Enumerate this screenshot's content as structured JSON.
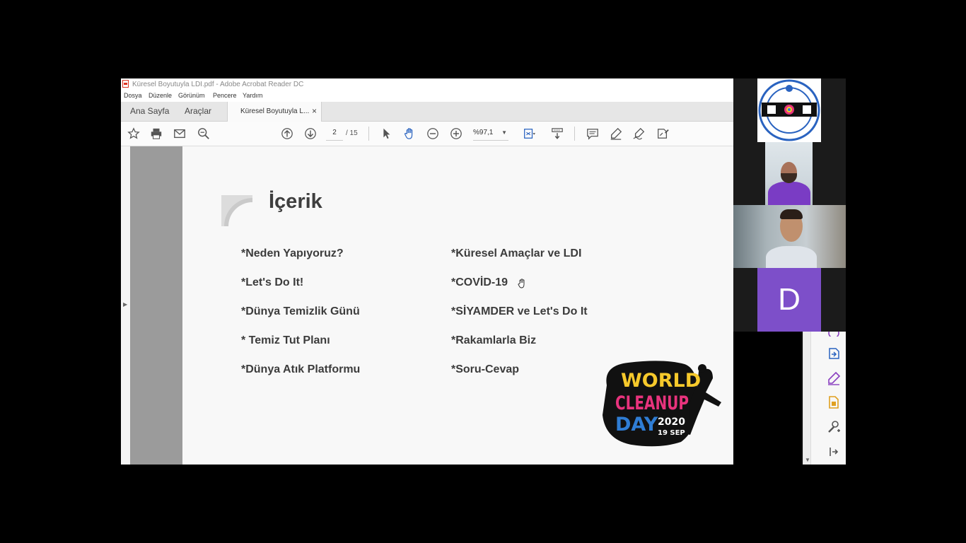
{
  "window": {
    "title": "Küresel Boyutuyla LDI.pdf - Adobe Acrobat Reader DC"
  },
  "menu": [
    "Dosya",
    "Düzenle",
    "Görünüm",
    "Pencere",
    "Yardım"
  ],
  "tabs": {
    "home": "Ana Sayfa",
    "tools": "Araçlar",
    "document": "Küresel Boyutuyla L...",
    "close_glyph": "×"
  },
  "toolbar": {
    "current_page": "2",
    "total_pages": "/ 15",
    "zoom": "%97,1",
    "icons": [
      "star-icon",
      "print-icon",
      "email-icon",
      "search-zoom-icon",
      "page-up-icon",
      "page-down-icon",
      "select-cursor-icon",
      "hand-icon",
      "zoom-out-icon",
      "zoom-in-icon",
      "fit-page-icon",
      "scroll-mode-icon",
      "comment-icon",
      "highlight-icon",
      "sign-icon",
      "edit-pdf-icon"
    ]
  },
  "document": {
    "title": "İçerik",
    "items_left": [
      "*Neden Yapıyoruz?",
      "*Let's Do It!",
      "*Dünya Temizlik Günü",
      "* Temiz Tut Planı",
      "*Dünya Atık Platformu"
    ],
    "items_right": [
      "*Küresel Amaçlar ve LDI",
      "*COVİD-19",
      "*SİYAMDER ve Let's Do It",
      "*Rakamlarla Biz",
      "*Soru-Cevap"
    ],
    "logo": {
      "line1": "WORLD",
      "line2": "CLEANUP",
      "line3": "DAY",
      "year": "2020",
      "date": "19 SEP"
    }
  },
  "video": {
    "avatar_letter": "D"
  },
  "colors": {
    "avatar_bg": "#7d4fc9",
    "logo_yellow": "#f6c92b",
    "logo_pink": "#e8337d",
    "logo_blue": "#2f7dd4",
    "icon_blue": "#2a63c0",
    "icon_purple": "#8a3fc0",
    "icon_orange": "#e0a020"
  }
}
